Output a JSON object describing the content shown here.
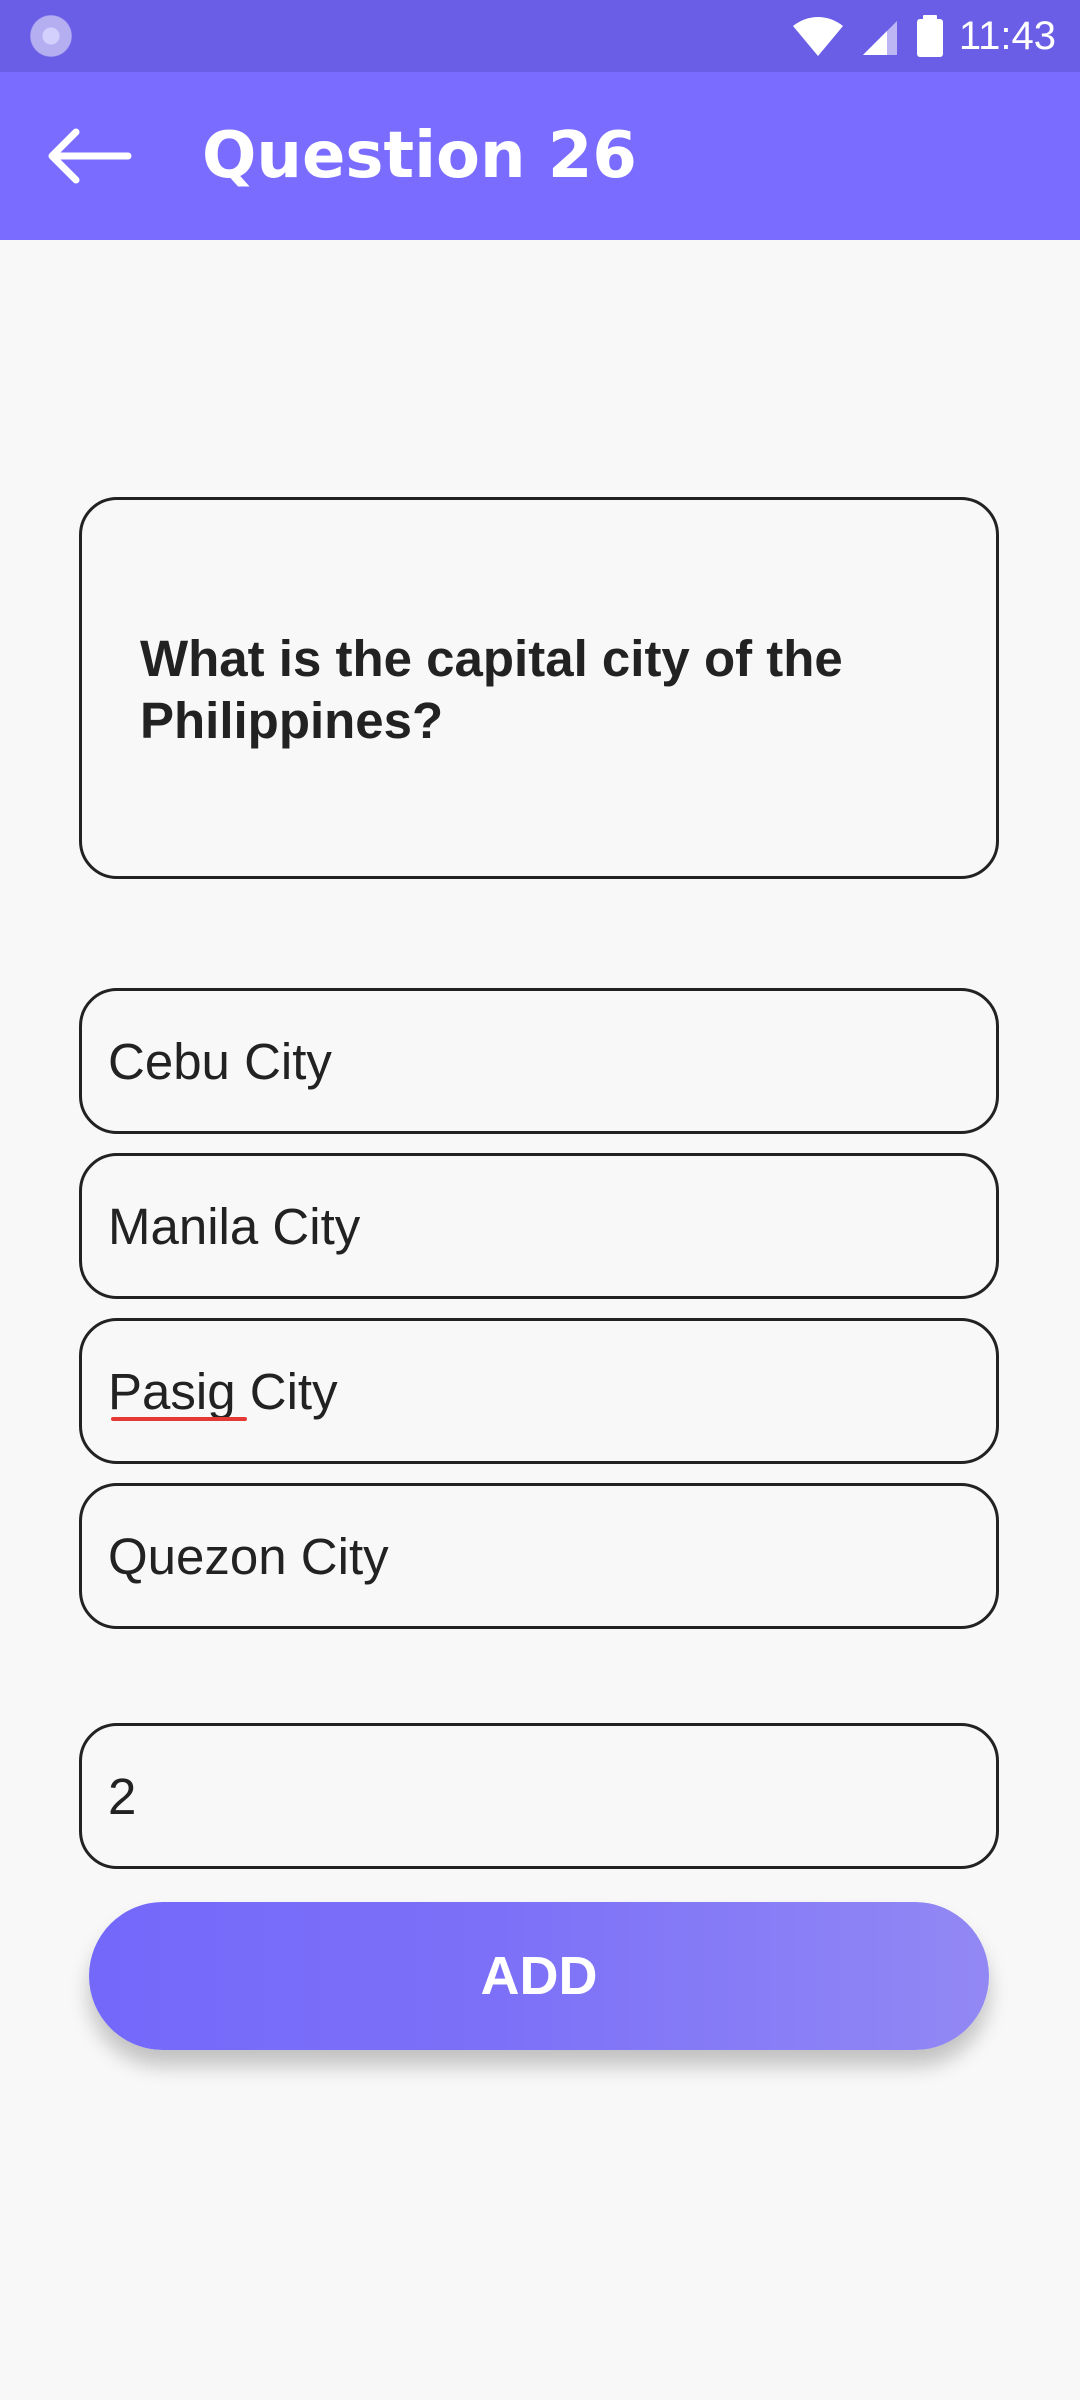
{
  "status_bar": {
    "time": "11:43",
    "icons": [
      "notification-icon",
      "wifi-icon",
      "signal-icon",
      "battery-icon"
    ]
  },
  "app_bar": {
    "title": "Question 26",
    "back_icon": "arrow-left-icon"
  },
  "question": {
    "text": "What is the capital city of the Philippines?"
  },
  "options": [
    {
      "value": "Cebu City"
    },
    {
      "value": "Manila City"
    },
    {
      "value": "Pasig City"
    },
    {
      "value": "Quezon City"
    }
  ],
  "answer": {
    "value": "2"
  },
  "actions": {
    "add_label": "ADD"
  },
  "colors": {
    "status_bar": "#6b5ee6",
    "app_bar": "#7a6cff",
    "button_start": "#7468fb",
    "button_end": "#9288f4",
    "border": "#222222",
    "spellcheck": "#e53935"
  }
}
